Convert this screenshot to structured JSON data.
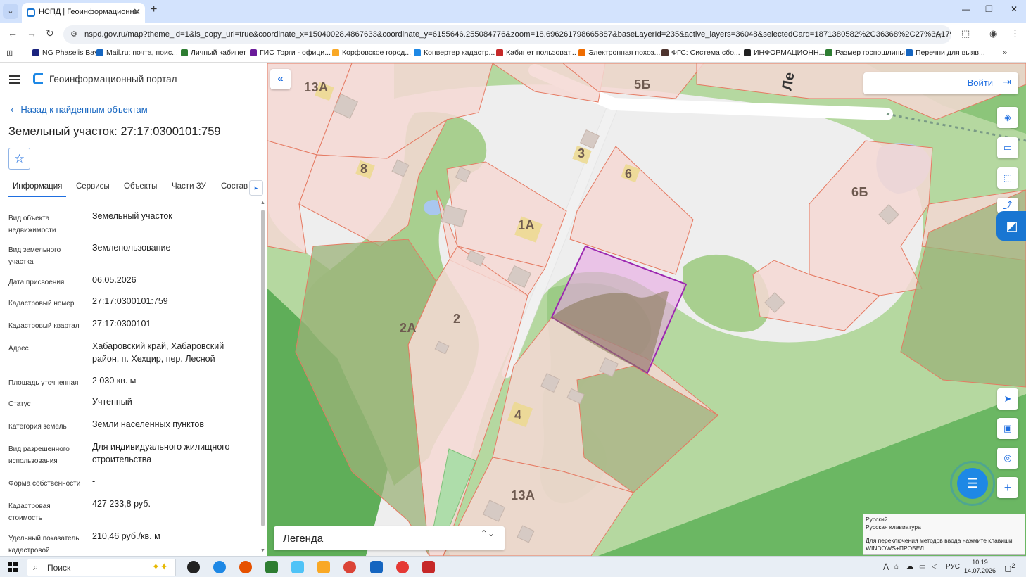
{
  "browser": {
    "tab_title": "НСПД | Геоинформационны",
    "tab_close": "✕",
    "new_tab": "+",
    "url": "nspd.gov.ru/map?theme_id=1&is_copy_url=true&coordinate_x=15040028.4867633&coordinate_y=6155646.255084776&zoom=18.696261798665887&baseLayerId=235&active_layers=36048&selectedCard=1871380582%2C36368%2C27%3A17%3A0300...",
    "window_controls": [
      "—",
      "❐",
      "✕"
    ],
    "bookmarks": [
      {
        "label": "NG Phaselis Bay",
        "color": "#1a237e"
      },
      {
        "label": "Mail.ru: почта, поис...",
        "color": "#1565c0"
      },
      {
        "label": "Личный кабинет",
        "color": "#2e7d32"
      },
      {
        "label": "ГИС Торги - офици...",
        "color": "#6a1b9a"
      },
      {
        "label": "Корфовское город...",
        "color": "#f9a825"
      },
      {
        "label": "Конвертер кадастр...",
        "color": "#1e88e5"
      },
      {
        "label": "Кабинет пользоват...",
        "color": "#c62828"
      },
      {
        "label": "Электронная похоз...",
        "color": "#ef6c00"
      },
      {
        "label": "ФГС: Система сбо...",
        "color": "#4e342e"
      },
      {
        "label": "ИНФОРМАЦИОНН...",
        "color": "#212121"
      },
      {
        "label": "Размер госпошлины",
        "color": "#2e7d32"
      },
      {
        "label": "Перечни для выяв...",
        "color": "#1565c0"
      }
    ]
  },
  "panel": {
    "portal_title": "Геоинформационный портал",
    "back_link": "Назад к найденным объектам",
    "object_title": "Земельный участок: 27:17:0300101:759",
    "favorite_icon": "☆",
    "tabs": [
      "Информация",
      "Сервисы",
      "Объекты",
      "Части ЗУ",
      "Состав"
    ],
    "tabs_arrow": "▸",
    "info": [
      {
        "label": "Вид объекта недвижимости",
        "value": "Земельный участок"
      },
      {
        "label": "Вид земельного участка",
        "value": "Землепользование"
      },
      {
        "label": "Дата присвоения",
        "value": "06.05.2026"
      },
      {
        "label": "Кадастровый номер",
        "value": "27:17:0300101:759"
      },
      {
        "label": "Кадастровый квартал",
        "value": "27:17:0300101"
      },
      {
        "label": "Адрес",
        "value": "Хабаровский край, Хабаровский район, п. Хехцир, пер. Лесной"
      },
      {
        "label": "Площадь уточненная",
        "value": "2 030 кв. м"
      },
      {
        "label": "Статус",
        "value": "Учтенный"
      },
      {
        "label": "Категория земель",
        "value": "Земли населенных пунктов"
      },
      {
        "label": "Вид разрешенного использования",
        "value": "Для индивидуального жилищного строительства"
      },
      {
        "label": "Форма собственности",
        "value": "-"
      },
      {
        "label": "Кадастровая стоимость",
        "value": "427 233,8 руб."
      },
      {
        "label": "Удельный показатель кадастровой",
        "value": "210,46 руб./кв. м"
      }
    ]
  },
  "map": {
    "labels": [
      "13А",
      "5Б",
      "8",
      "3",
      "6",
      "6Б",
      "1А",
      "2А",
      "2",
      "4",
      "13А",
      "Ле"
    ],
    "collapse_icon": "«",
    "login_label": "Войти",
    "login_icon": "⇥",
    "controls": [
      "layers-icon",
      "ruler-icon",
      "select-area-icon",
      "share-icon",
      "locate-icon",
      "picture-in-picture-icon",
      "search-location-icon",
      "zoom-in-icon"
    ],
    "control_glyphs": [
      "◈",
      "▭",
      "⬚",
      "⤴",
      "➤",
      "▣",
      "◎",
      "+"
    ],
    "legend_label": "Легенда",
    "legend_arrow": "⌃⌄",
    "chat_icon": "☰",
    "assistant_icon": "◩",
    "colors": {
      "parcel_fill": "#f6d9d4",
      "parcel_stroke": "#e57a62",
      "selected_stroke": "#9c27b0",
      "forest": "#5aaa55"
    }
  },
  "ime_tooltip": {
    "line1": "Русский",
    "line2": "Русская клавиатура",
    "line3": "Для переключения методов ввода нажмите клавиши WINDOWS+ПРОБЕЛ."
  },
  "taskbar": {
    "search_placeholder": "Поиск",
    "search_spark": "✦✦",
    "tray_caret": "⋀",
    "language": "РУС",
    "time": "10:19",
    "date": "14.07.2026",
    "notification_count": "2",
    "apps": [
      {
        "name": "copilot-app-icon",
        "color": "#222"
      },
      {
        "name": "edge-app-icon",
        "color": "#1e88e5"
      },
      {
        "name": "firefox-app-icon",
        "color": "#e65100"
      },
      {
        "name": "excel-app-icon",
        "color": "#2e7d32"
      },
      {
        "name": "store-app-icon",
        "color": "#4fc3f7"
      },
      {
        "name": "file-explorer-app-icon",
        "color": "#f9a825"
      },
      {
        "name": "chrome-app-icon",
        "color": "#db4437"
      },
      {
        "name": "word-app-icon",
        "color": "#1565c0"
      },
      {
        "name": "yandex-app-icon",
        "color": "#e53935"
      },
      {
        "name": "pdf-app-icon",
        "color": "#c62828"
      }
    ]
  }
}
